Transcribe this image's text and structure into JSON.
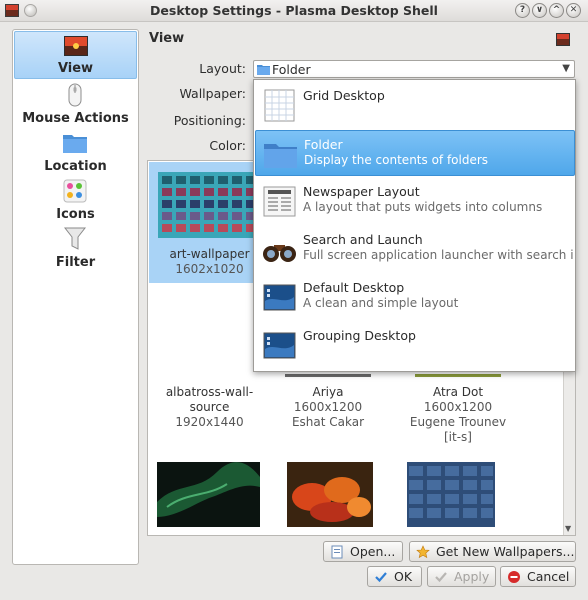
{
  "window": {
    "title": "Desktop Settings - Plasma Desktop Shell",
    "buttons": [
      "?",
      "∨",
      "^",
      "✕"
    ]
  },
  "sidebar": {
    "items": [
      {
        "label": "View",
        "icon": "view-wallpaper-icon",
        "selected": true
      },
      {
        "label": "Mouse Actions",
        "icon": "mouse-icon",
        "selected": false
      },
      {
        "label": "Location",
        "icon": "folder-icon",
        "selected": false
      },
      {
        "label": "Icons",
        "icon": "icons-palette-icon",
        "selected": false
      },
      {
        "label": "Filter",
        "icon": "filter-funnel-icon",
        "selected": false
      }
    ]
  },
  "main": {
    "section_title": "View",
    "labels": {
      "layout": "Layout:",
      "wallpaper": "Wallpaper:",
      "positioning": "Positioning:",
      "color": "Color:"
    },
    "layout_value": "Folder"
  },
  "layout_options": [
    {
      "name": "Grid Desktop",
      "desc": "",
      "icon": "grid-desktop-icon",
      "selected": false
    },
    {
      "name": "Folder",
      "desc": "Display the contents of folders",
      "icon": "folder-icon",
      "selected": true
    },
    {
      "name": "Newspaper Layout",
      "desc": "A layout that puts widgets into columns",
      "icon": "newspaper-icon",
      "selected": false
    },
    {
      "name": "Search and Launch",
      "desc": "Full screen application launcher with search in",
      "icon": "binoculars-icon",
      "selected": false
    },
    {
      "name": "Default Desktop",
      "desc": "A clean and simple layout",
      "icon": "desktop-screen-icon",
      "selected": false
    },
    {
      "name": "Grouping Desktop",
      "desc": "",
      "icon": "desktop-screen-icon",
      "selected": false
    }
  ],
  "wallpapers": [
    {
      "name": "art-wallpaper",
      "size": "1602x1020",
      "author": "",
      "selected": true
    },
    {
      "name": "albatross-wall-source",
      "name_line1": "albatross-wall-",
      "name_line2": "source",
      "size": "1920x1440",
      "author": ""
    },
    {
      "name": "Ariya",
      "size": "1600x1200",
      "author": "Eshat Cakar"
    },
    {
      "name": "Atra Dot",
      "size": "1600x1200",
      "author": "Eugene Trounev",
      "author2": "[it-s]"
    }
  ],
  "buttons": {
    "open": "Open...",
    "get_new": "Get New Wallpapers...",
    "ok": "OK",
    "apply": "Apply",
    "cancel": "Cancel"
  },
  "colors": {
    "selection": "#a9d3f6",
    "popup_selection": "#5bb0ee",
    "window_bg": "#e9e8e6"
  }
}
